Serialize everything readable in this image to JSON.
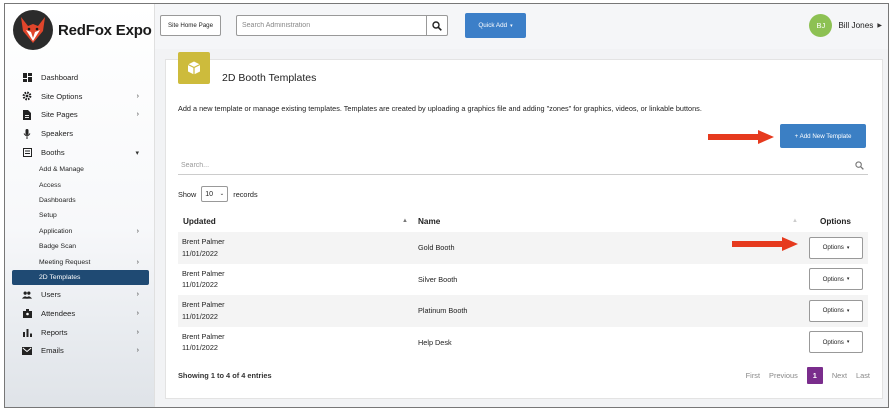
{
  "brand": {
    "name": "RedFox Expo"
  },
  "topbar": {
    "site_home_label": "Site Home Page",
    "search_placeholder": "Search Administration",
    "quick_add_label": "Quick Add",
    "user_initials": "BJ",
    "user_name": "Bill Jones"
  },
  "sidebar": {
    "items": [
      {
        "label": "Dashboard",
        "icon": "dashboard-icon"
      },
      {
        "label": "Site Options",
        "icon": "gear-icon",
        "expandable": true
      },
      {
        "label": "Site Pages",
        "icon": "file-icon",
        "expandable": true
      },
      {
        "label": "Speakers",
        "icon": "microphone-icon"
      },
      {
        "label": "Booths",
        "icon": "booth-icon",
        "expanded": true
      }
    ],
    "booth_subitems": [
      {
        "label": "Add & Manage"
      },
      {
        "label": "Access"
      },
      {
        "label": "Dashboards"
      },
      {
        "label": "Setup"
      },
      {
        "label": "Application",
        "expandable": true
      },
      {
        "label": "Badge Scan"
      },
      {
        "label": "Meeting Request",
        "expandable": true
      },
      {
        "label": "2D Templates",
        "active": true
      }
    ],
    "items_after": [
      {
        "label": "Users",
        "icon": "users-icon",
        "expandable": true
      },
      {
        "label": "Attendees",
        "icon": "attendees-icon",
        "expandable": true
      },
      {
        "label": "Reports",
        "icon": "chart-icon",
        "expandable": true
      },
      {
        "label": "Emails",
        "icon": "mail-icon",
        "expandable": true
      }
    ]
  },
  "main": {
    "title": "2D Booth Templates",
    "description": "Add a new template or manage existing templates. Templates are created by uploading a graphics file and adding \"zones\" for graphics, videos, or linkable buttons.",
    "add_button_label": "+ Add New Template",
    "search_placeholder": "Search...",
    "show_label": "Show",
    "show_value": "10",
    "records_label": "records",
    "columns": {
      "updated": "Updated",
      "name": "Name",
      "options": "Options"
    },
    "rows": [
      {
        "updated_by": "Brent Palmer",
        "updated_date": "11/01/2022",
        "name": "Gold Booth",
        "options_label": "Options"
      },
      {
        "updated_by": "Brent Palmer",
        "updated_date": "11/01/2022",
        "name": "Silver Booth",
        "options_label": "Options"
      },
      {
        "updated_by": "Brent Palmer",
        "updated_date": "11/01/2022",
        "name": "Platinum Booth",
        "options_label": "Options"
      },
      {
        "updated_by": "Brent Palmer",
        "updated_date": "11/01/2022",
        "name": "Help Desk",
        "options_label": "Options"
      }
    ],
    "entries_info": "Showing 1 to 4 of 4 entries",
    "pager": {
      "first": "First",
      "previous": "Previous",
      "current": "1",
      "next": "Next",
      "last": "Last"
    }
  },
  "colors": {
    "accent": "#3b7fc4",
    "sidebar_active": "#1f4a73",
    "arrow": "#e63a1e",
    "title_icon": "#cdbb3c",
    "pager_active": "#7a2d8c",
    "avatar": "#8dc153"
  }
}
